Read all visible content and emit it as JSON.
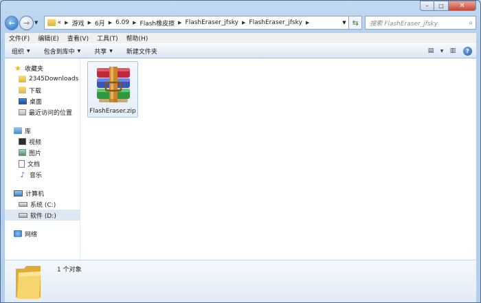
{
  "window": {
    "caption": {
      "minimize": "–",
      "maximize": "□",
      "close": "✕"
    }
  },
  "nav": {
    "back_icon": "arrow-left-icon",
    "forward_icon": "arrow-right-icon",
    "address": {
      "overflow": "«",
      "crumbs": [
        "游戏",
        "6月",
        "6.09",
        "Flash橡皮擦",
        "FlashEraser_jfsky",
        "FlashEraser_jfsky"
      ]
    },
    "search_placeholder": "搜索 FlashEraser_jfsky"
  },
  "menu": [
    "文件(F)",
    "编辑(E)",
    "查看(V)",
    "工具(T)",
    "帮助(H)"
  ],
  "toolbar": {
    "organize": "组织",
    "include_library": "包含到库中",
    "share": "共享",
    "new_folder": "新建文件夹",
    "help": "?"
  },
  "sidebar": {
    "favorites": {
      "label": "收藏夹",
      "items": [
        "2345Downloads",
        "下载",
        "桌面",
        "最近访问的位置"
      ]
    },
    "libraries": {
      "label": "库",
      "items": [
        "视频",
        "图片",
        "文档",
        "音乐"
      ]
    },
    "computer": {
      "label": "计算机",
      "items": [
        "系统 (C:)",
        "软件 (D:)"
      ]
    },
    "network": {
      "label": "网络"
    }
  },
  "files": [
    {
      "name": "FlashEraser.zip",
      "icon": "winrar-archive-icon"
    }
  ],
  "details": {
    "count": "1 个对象"
  },
  "colors": {
    "accent": "#2c6fc4",
    "selection": "#dde8f5",
    "frame": "#b4cfec"
  }
}
